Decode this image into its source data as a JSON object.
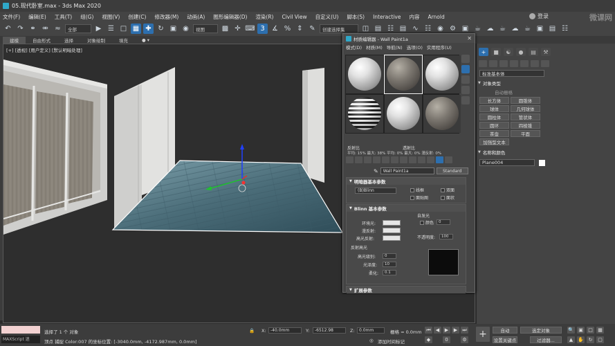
{
  "titlebar": {
    "title": "05.现代卧室.max - 3ds Max 2020"
  },
  "menubar": {
    "items": [
      "文件(F)",
      "编辑(E)",
      "工具(T)",
      "组(G)",
      "视图(V)",
      "创建(C)",
      "修改器(M)",
      "动画(A)",
      "图形编辑器(D)",
      "渲染(R)",
      "Civil View",
      "自定义(U)",
      "脚本(S)",
      "Interactive",
      "内容",
      "Arnold"
    ],
    "login": "登录",
    "watermark": "微课网"
  },
  "toolbar": {
    "filter": "全部",
    "view": "视图",
    "selection_set": "创建选择集"
  },
  "ribbon": {
    "tabs": [
      "建模",
      "自由形式",
      "选择",
      "对象绘制",
      "填充"
    ]
  },
  "viewport": {
    "label": "[+] [透视] [用户定义] [默认明暗处理]"
  },
  "material_editor": {
    "title": "材质编辑器 - Wall Paint1a",
    "menu": [
      "模式(D)",
      "材质(M)",
      "导航(N)",
      "选项(O)",
      "实用程序(U)"
    ],
    "labels": {
      "reflect": "反射比",
      "transmit": "透射比"
    },
    "stats": "平均: 15% 最大: 38%    平均: 0% 最大: 0% 漫反射: 0%",
    "material_name": "Wall Paint1a",
    "material_type": "Standard",
    "shader_rollout": {
      "header": "明暗器基本参数",
      "shader": "(B)Blinn",
      "wire": "线框",
      "two_sided": "双面",
      "face_map": "面贴图",
      "faceted": "面状"
    },
    "blinn_rollout": {
      "header": "Blinn 基本参数",
      "self_illum": "自发光",
      "color": "颜色",
      "color_value": "0",
      "ambient": "环境光:",
      "diffuse": "漫反射:",
      "specular": "高光反射:",
      "opacity": "不透明度:",
      "opacity_value": "100",
      "spec_highlights": "反射高光",
      "spec_level": "高光级别:",
      "spec_level_value": "0",
      "glossiness": "光泽度:",
      "glossiness_value": "10",
      "soften": "柔化:",
      "soften_value": "0.1"
    },
    "extended_rollout": {
      "header": "扩展参数"
    }
  },
  "command_panel": {
    "category": "标准基本体",
    "object_type": "对象类型",
    "autogrid": "自动栅格",
    "primitives": [
      "长方体",
      "圆锥体",
      "球体",
      "几何球体",
      "圆柱体",
      "管状体",
      "圆环",
      "四棱锥",
      "茶壶",
      "平面",
      "加强型文本"
    ],
    "name_color": "名称和颜色",
    "object_name": "Plane004"
  },
  "status": {
    "selected": "选择了 1 个 对象",
    "prompt": "顶点 捕捉 Color:007 的坐标位置: [-3040.0mm, -4172.987mm, 0.0mm]",
    "maxscript": "MAXScript 迷",
    "x": "-40.0mm",
    "y": "-6512.98",
    "z": "0.0mm",
    "grid": "栅格 = 0.0mm",
    "add_tag": "添加时间标记",
    "auto": "自动",
    "set_key": "设置关键点",
    "selected_obj": "选定对象",
    "filters": "过滤器..."
  }
}
